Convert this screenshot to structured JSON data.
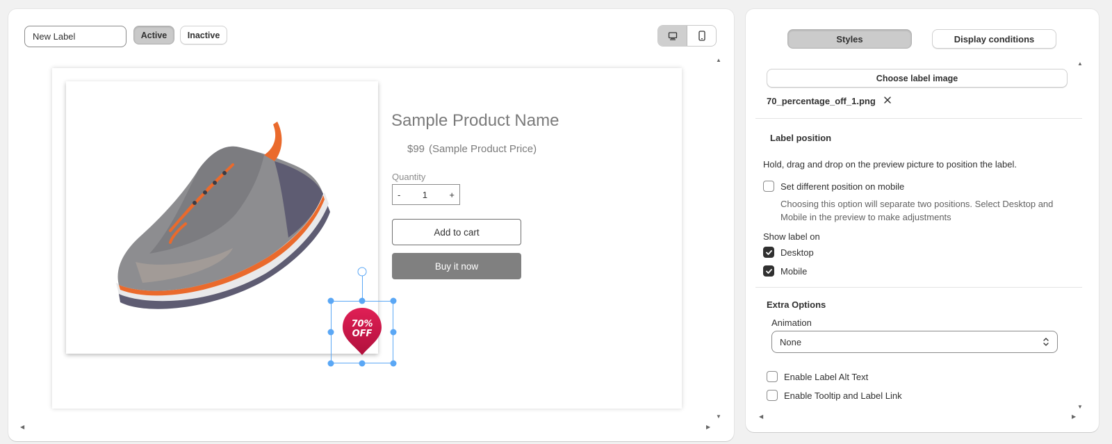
{
  "toolbar": {
    "label_name_value": "New Label",
    "active_label": "Active",
    "inactive_label": "Inactive",
    "devices": [
      {
        "name": "desktop",
        "icon": "desktop-icon",
        "selected": true
      },
      {
        "name": "mobile",
        "icon": "mobile-icon",
        "selected": false
      }
    ]
  },
  "preview": {
    "product_name": "Sample Product Name",
    "price": "$99",
    "price_note": "(Sample Product Price)",
    "quantity_label": "Quantity",
    "quantity_minus": "-",
    "quantity_value": "1",
    "quantity_plus": "+",
    "add_to_cart": "Add to cart",
    "buy_now": "Buy it now",
    "badge": {
      "line1": "70%",
      "line2": "OFF",
      "color": "#d2184a"
    }
  },
  "panel": {
    "tabs": {
      "styles": "Styles",
      "display_conditions": "Display conditions"
    },
    "choose_image": "Choose label image",
    "file_name": "70_percentage_off_1.png",
    "label_position": {
      "title": "Label position",
      "help": "Hold, drag and drop on the preview picture to position the label.",
      "different_mobile": "Set different position on mobile",
      "different_mobile_help": "Choosing this option will separate two positions. Select Desktop and Mobile in the preview to make adjustments",
      "show_label_on": "Show label on",
      "desktop": "Desktop",
      "mobile": "Mobile"
    },
    "extra_options": {
      "title": "Extra Options",
      "animation_label": "Animation",
      "animation_value": "None",
      "alt_text": "Enable Label Alt Text",
      "tooltip": "Enable Tooltip and Label Link"
    }
  },
  "colors": {
    "selection": "#5aa7f5",
    "badge": "#d2184a",
    "shoe_orange": "#ea6a2c"
  }
}
